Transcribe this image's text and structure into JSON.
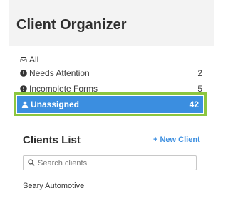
{
  "organizer": {
    "title": "Client Organizer",
    "filters": [
      {
        "label": "All",
        "count": "",
        "icon": "inbox-icon"
      },
      {
        "label": "Needs Attention",
        "count": "2",
        "icon": "exclamation-circle-icon"
      },
      {
        "label": "Incomplete Forms",
        "count": "5",
        "icon": "exclamation-circle-icon"
      },
      {
        "label": "Unassigned",
        "count": "42",
        "icon": "user-icon",
        "selected": true
      }
    ]
  },
  "clients": {
    "title": "Clients List",
    "new_client_label": "+ New Client",
    "search_placeholder": "Search clients",
    "search_value": "",
    "items": [
      "Seary Automotive"
    ]
  },
  "colors": {
    "accent": "#3b8ee0",
    "highlight": "#8cc63f",
    "header_bg": "#f3f3f3"
  }
}
